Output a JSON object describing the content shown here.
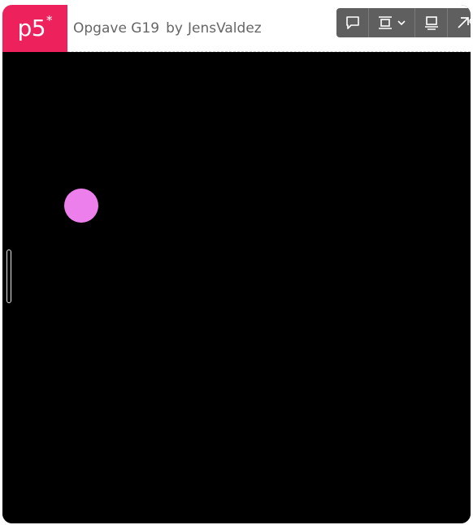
{
  "header": {
    "logo_text": "p5",
    "logo_star": "*",
    "sketch_name": "Opgave G19",
    "by_label": "by",
    "author": "JensValdez"
  },
  "toolbar": {
    "buttons": [
      {
        "icon": "comment-icon"
      },
      {
        "icon": "embed-frame-icon",
        "has_dropdown": true
      },
      {
        "icon": "display-icon"
      },
      {
        "icon": "open-external-icon"
      }
    ]
  },
  "sketch": {
    "background": "#000000",
    "ball_color": "#ed7fed"
  },
  "colors": {
    "brand": "#ed225d",
    "toolbar_bg": "#5f5f5f",
    "title_text": "#666666"
  }
}
